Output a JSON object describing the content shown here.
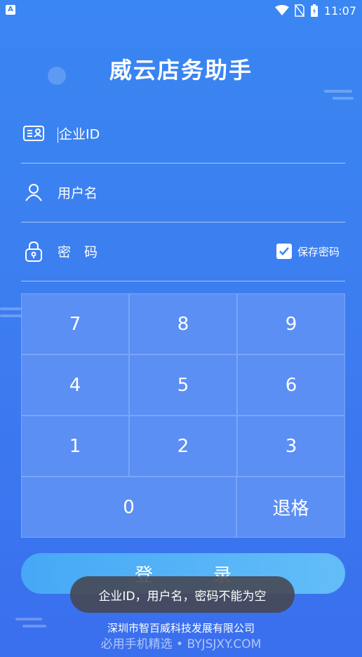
{
  "status_bar": {
    "time": "11:07",
    "notification_letter": "A"
  },
  "app": {
    "title": "威云店务助手"
  },
  "form": {
    "company_id_placeholder": "企业ID",
    "username_placeholder": "用户名",
    "password_placeholder": "密　码",
    "remember_label": "保存密码",
    "remember_checked": true
  },
  "keypad": {
    "keys": [
      "7",
      "8",
      "9",
      "4",
      "5",
      "6",
      "1",
      "2",
      "3"
    ],
    "zero": "0",
    "backspace": "退格"
  },
  "login_button": "登　录",
  "toast": "企业ID，用户名，密码不能为空",
  "footer": {
    "company": "深圳市智百威科技发展有限公司",
    "watermark": "必用手机精选 • BYJSJXY.COM"
  }
}
